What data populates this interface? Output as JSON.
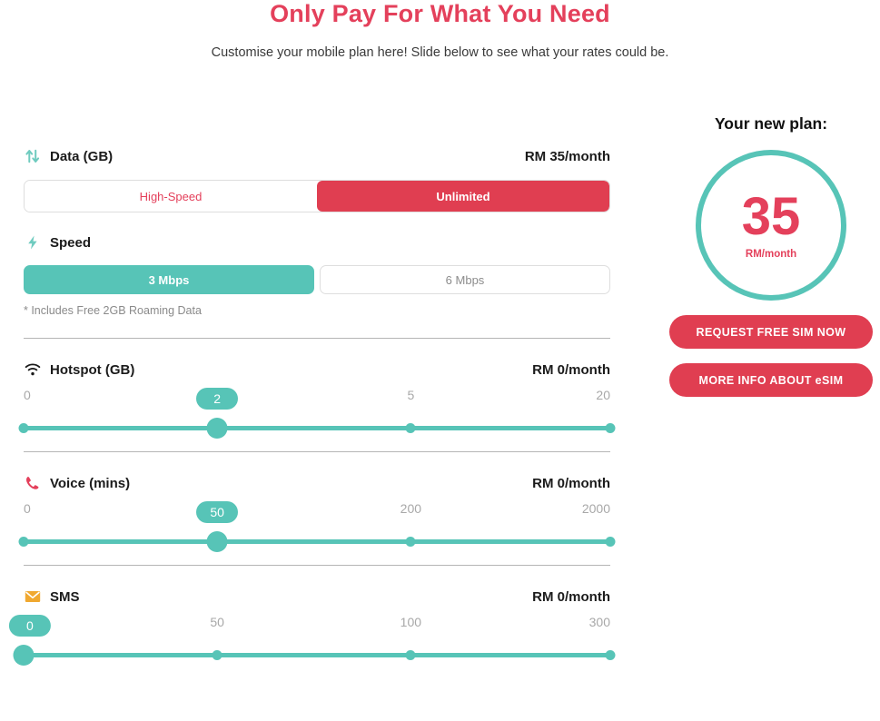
{
  "header": {
    "title": "Only Pay For What You Need",
    "subtitle": "Customise your mobile plan here! Slide below to see what your rates could be.",
    "title_color": "#E4405B"
  },
  "theme": {
    "accent_red": "#E03E51",
    "accent_teal": "#57C4B7",
    "icon_orange": "#F0A830",
    "muted_gray": "#a8a8a8"
  },
  "sections": {
    "data": {
      "label": "Data (GB)",
      "price": "RM 35/month",
      "icon": "up-down-arrows-icon",
      "options": [
        {
          "label": "High-Speed",
          "selected": false
        },
        {
          "label": "Unlimited",
          "selected": true
        }
      ]
    },
    "speed": {
      "label": "Speed",
      "icon": "lightning-bolt-icon",
      "options": [
        {
          "label": "3 Mbps",
          "selected": true
        },
        {
          "label": "6 Mbps",
          "selected": false
        }
      ],
      "note": "* Includes Free 2GB Roaming Data"
    },
    "hotspot": {
      "label": "Hotspot (GB)",
      "price": "RM 0/month",
      "icon": "wifi-icon",
      "value": "2",
      "value_percent": 33,
      "ticks": [
        {
          "label": "0",
          "percent": 0
        },
        {
          "label": "2",
          "percent": 33
        },
        {
          "label": "5",
          "percent": 66
        },
        {
          "label": "20",
          "percent": 100
        }
      ]
    },
    "voice": {
      "label": "Voice (mins)",
      "price": "RM 0/month",
      "icon": "phone-icon",
      "value": "50",
      "value_percent": 33,
      "ticks": [
        {
          "label": "0",
          "percent": 0
        },
        {
          "label": "50",
          "percent": 33
        },
        {
          "label": "200",
          "percent": 66
        },
        {
          "label": "2000",
          "percent": 100
        }
      ]
    },
    "sms": {
      "label": "SMS",
      "price": "RM 0/month",
      "icon": "envelope-icon",
      "value": "0",
      "value_percent": 0,
      "ticks": [
        {
          "label": "0",
          "percent": 0
        },
        {
          "label": "50",
          "percent": 33
        },
        {
          "label": "100",
          "percent": 66
        },
        {
          "label": "300",
          "percent": 100
        }
      ]
    }
  },
  "summary": {
    "title": "Your new plan:",
    "amount": "35",
    "unit": "RM/month",
    "primary_cta": "REQUEST FREE SIM NOW",
    "secondary_cta": "MORE INFO ABOUT eSIM"
  }
}
